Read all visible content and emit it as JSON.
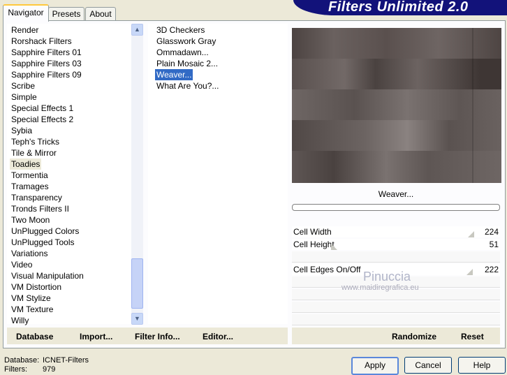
{
  "tabs": [
    "Navigator",
    "Presets",
    "About"
  ],
  "banner_title": "Filters Unlimited 2.0",
  "categories": [
    "Render",
    "Rorshack Filters",
    "Sapphire Filters 01",
    "Sapphire Filters 03",
    "Sapphire Filters 09",
    "Scribe",
    "Simple",
    "Special Effects 1",
    "Special Effects 2",
    "Sybia",
    "Teph's Tricks",
    "Tile & Mirror",
    "Toadies",
    "Tormentia",
    "Tramages",
    "Transparency",
    "Tronds Filters II",
    "Two Moon",
    "UnPlugged Colors",
    "UnPlugged Tools",
    "Variations",
    "Video",
    "Visual Manipulation",
    "VM Distortion",
    "VM Stylize",
    "VM Texture",
    "Willy"
  ],
  "selected_category": "Toadies",
  "filters": [
    "3D Checkers",
    "Glasswork Gray",
    "Ommadawn...",
    "Plain Mosaic 2...",
    "Weaver...",
    "What Are You?..."
  ],
  "selected_filter": "Weaver...",
  "preview_filter_name": "Weaver...",
  "params": [
    {
      "label": "Cell Width",
      "value": "224"
    },
    {
      "label": "Cell Height",
      "value": "51"
    },
    {
      "label": "Cell Edges On/Off",
      "value": "222"
    }
  ],
  "watermark": {
    "line1": "Pinuccia",
    "line2": "www.maidiregrafica.eu"
  },
  "left_commands": [
    "Database",
    "Import...",
    "Filter Info...",
    "Editor..."
  ],
  "right_commands": [
    "Randomize",
    "Reset"
  ],
  "status": {
    "database_label": "Database:",
    "database_value": "ICNET-Filters",
    "filters_label": "Filters:",
    "filters_value": "979"
  },
  "buttons": {
    "apply": "Apply",
    "cancel": "Cancel",
    "help": "Help"
  },
  "colors": {
    "selection_blue": "#316AC5",
    "banner": "#12127A",
    "tab_highlight": "#FFC83C"
  }
}
